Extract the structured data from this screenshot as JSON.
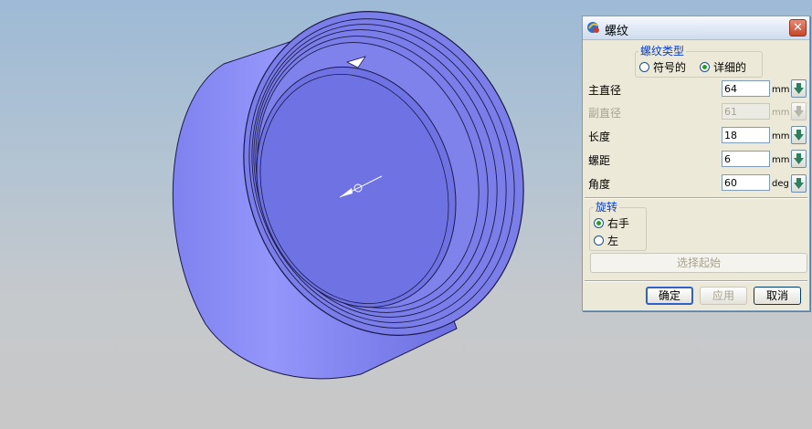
{
  "dialog": {
    "title": "螺纹",
    "close_label": "✕",
    "thread_type": {
      "title": "螺纹类型",
      "options": [
        {
          "label": "符号的",
          "selected": false
        },
        {
          "label": "详细的",
          "selected": true
        }
      ]
    },
    "fields": [
      {
        "label": "主直径",
        "value": "64",
        "unit": "mm",
        "enabled": true
      },
      {
        "label": "副直径",
        "value": "61",
        "unit": "mm",
        "enabled": false
      },
      {
        "label": "长度",
        "value": "18",
        "unit": "mm",
        "enabled": true
      },
      {
        "label": "螺距",
        "value": "6",
        "unit": "mm",
        "enabled": true
      },
      {
        "label": "角度",
        "value": "60",
        "unit": "deg",
        "enabled": true
      }
    ],
    "rotation": {
      "title": "旋转",
      "options": [
        {
          "label": "右手",
          "selected": true
        },
        {
          "label": "左",
          "selected": false
        }
      ]
    },
    "select_start_label": "选择起始",
    "ok_label": "确定",
    "apply_label": "应用",
    "cancel_label": "取消"
  },
  "colors": {
    "part_face": "#7b7ee8",
    "part_side": "#8a8cf2",
    "edge": "#1a1a4a",
    "dialog_bg": "#ece9d8",
    "group_title": "#0c3ec1",
    "arrow_green": "#2f7f5f"
  }
}
